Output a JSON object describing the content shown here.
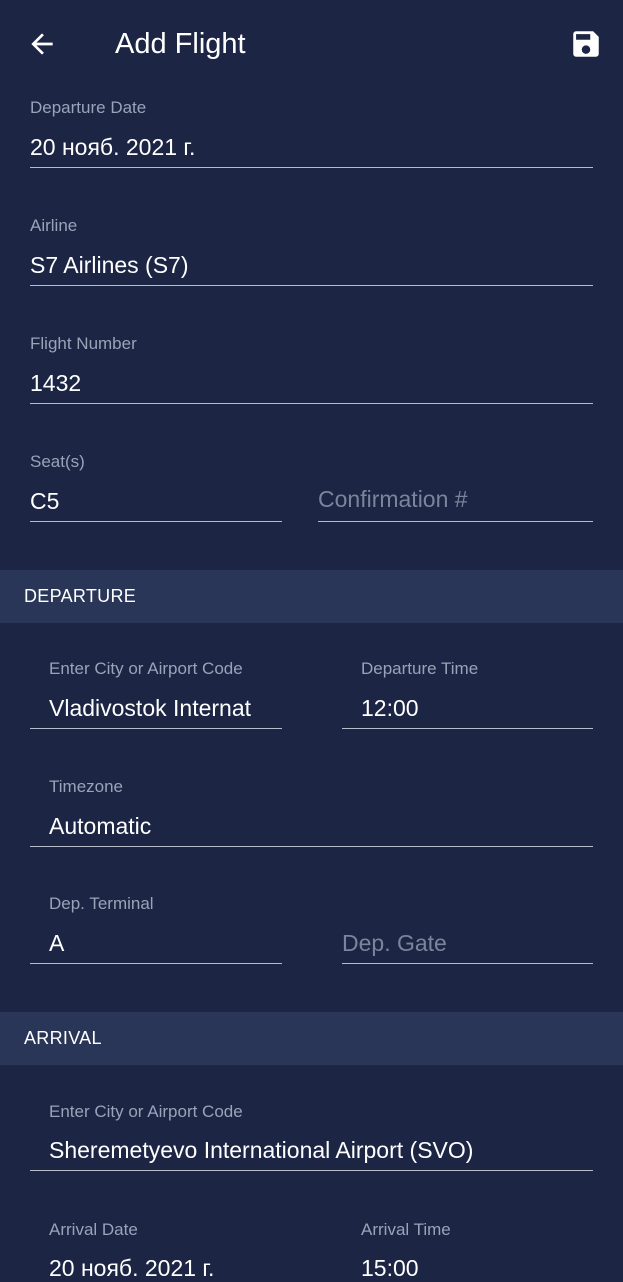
{
  "appbar": {
    "title": "Add Flight",
    "back_icon": "arrow-left-icon",
    "save_icon": "floppy-disk-icon"
  },
  "flight": {
    "departure_date": {
      "label": "Departure Date",
      "value": "20 нояб. 2021 г."
    },
    "airline": {
      "label": "Airline",
      "value": "S7 Airlines (S7)"
    },
    "flight_number": {
      "label": "Flight Number",
      "value": "1432"
    },
    "seats": {
      "label": "Seat(s)",
      "value": "C5"
    },
    "confirmation": {
      "placeholder": "Confirmation #"
    }
  },
  "departure": {
    "header": "DEPARTURE",
    "city": {
      "label": "Enter City or Airport Code",
      "value": "Vladivostok Internat"
    },
    "time": {
      "label": "Departure Time",
      "value": "12:00"
    },
    "timezone": {
      "label": "Timezone",
      "value": "Automatic"
    },
    "terminal": {
      "label": "Dep. Terminal",
      "value": "A"
    },
    "gate": {
      "placeholder": "Dep. Gate"
    }
  },
  "arrival": {
    "header": "ARRIVAL",
    "city": {
      "label": "Enter City or Airport Code",
      "value": "Sheremetyevo International Airport (SVO)"
    },
    "date": {
      "label": "Arrival Date",
      "value": "20 нояб. 2021 г."
    },
    "time": {
      "label": "Arrival Time",
      "value": "15:00"
    }
  },
  "colors": {
    "background": "#1c2544",
    "section_header_bg": "#2a3658",
    "label": "#9aa3b8",
    "placeholder": "#7c849b",
    "underline": "#b8bdcc",
    "text": "#ffffff"
  }
}
